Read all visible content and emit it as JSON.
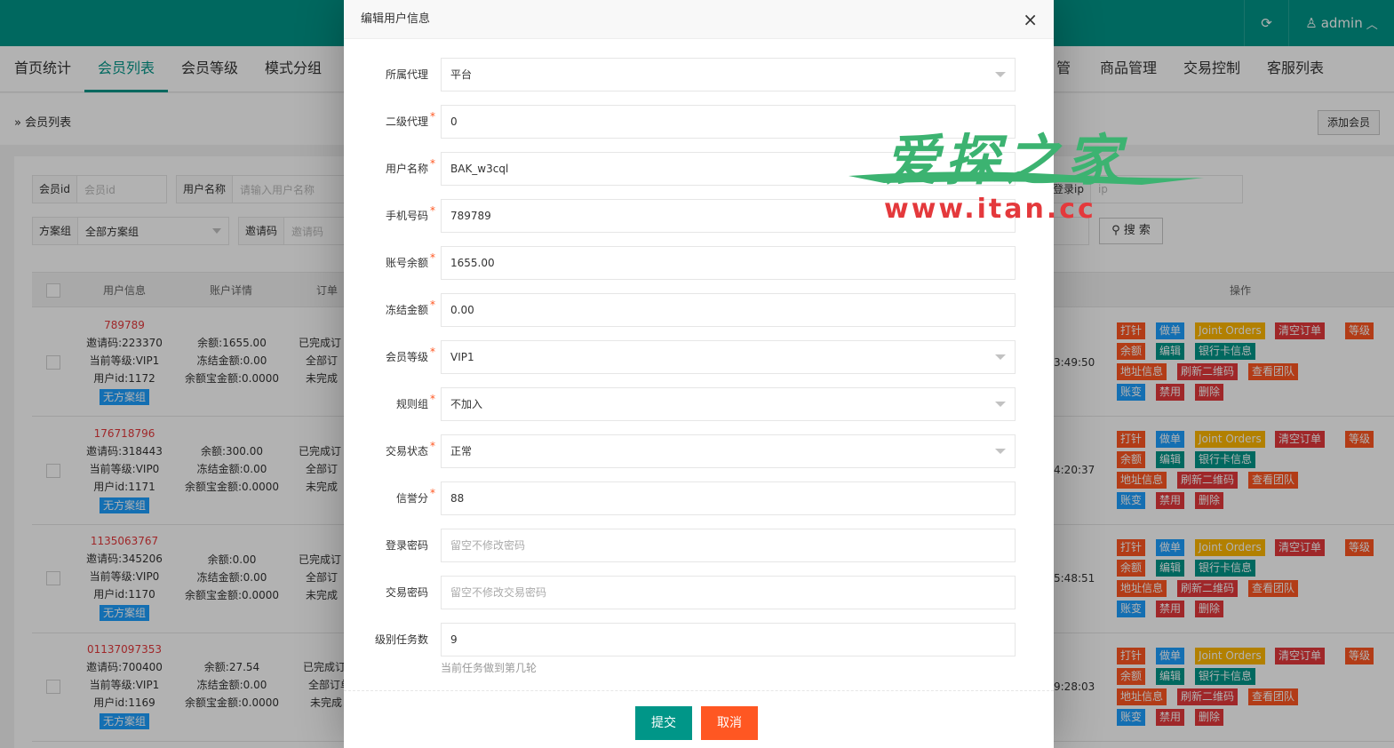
{
  "topbar": {
    "refresh_icon": "⟳",
    "user_icon": "♙",
    "username": "admin",
    "chevron": "︿"
  },
  "nav": {
    "left": [
      "首页统计",
      "会员列表",
      "会员等级",
      "模式分组"
    ],
    "right": [
      "管理",
      "商品管理",
      "交易控制",
      "客服列表"
    ]
  },
  "breadcrumb": "» 会员列表",
  "add_member": "添加会员",
  "filters": {
    "member_id_label": "会员id",
    "member_id_ph": "会员id",
    "username_label": "用户名称",
    "username_ph": "请输入用户名称",
    "login_ip_label": "登录ip",
    "login_ip_ph": "ip",
    "plan_label": "方案组",
    "plan_value": "全部方案组",
    "invite_label": "邀请码",
    "invite_ph": "邀请码",
    "search": "搜 索"
  },
  "table": {
    "headers": {
      "user": "用户信息",
      "account": "账户详情",
      "orders": "订单",
      "ops": "操作"
    },
    "rows": [
      {
        "phone": "789789",
        "invite": "邀请码:223370",
        "level": "当前等级:VIP1",
        "uid": "用户id:1172",
        "plan": "无方案组",
        "balance": "余额:1655.00",
        "frozen": "冻结金额:0.00",
        "yeb": "余额宝金额:0.0000",
        "o1": "已完成订",
        "o2": "全部订",
        "o3": "未完成",
        "time": "3:49:50"
      },
      {
        "phone": "176718796",
        "invite": "邀请码:318443",
        "level": "当前等级:VIP0",
        "uid": "用户id:1171",
        "plan": "无方案组",
        "balance": "余额:300.00",
        "frozen": "冻结金额:0.00",
        "yeb": "余额宝金额:0.0000",
        "o1": "已完成订",
        "o2": "全部订",
        "o3": "未完成",
        "time": "4:20:37"
      },
      {
        "phone": "1135063767",
        "invite": "邀请码:345206",
        "level": "当前等级:VIP0",
        "uid": "用户id:1170",
        "plan": "无方案组",
        "balance": "余额:0.00",
        "frozen": "冻结金额:0.00",
        "yeb": "余额宝金额:0.0000",
        "o1": "已完成订",
        "o2": "全部订",
        "o3": "未完成",
        "time": "5:48:51"
      },
      {
        "phone": "01137097353",
        "invite": "邀请码:700400",
        "level": "当前等级:VIP1",
        "uid": "用户id:1169",
        "plan": "无方案组",
        "balance": "余额:27.54",
        "frozen": "冻结金额:0.00",
        "yeb": "余额宝金额:0.0000",
        "o1": "已完成订",
        "o2": "全部订单",
        "o3": "未完成",
        "time": "9:28:03"
      }
    ],
    "ops": {
      "hit": "打针",
      "do": "做单",
      "joint": "Joint Orders",
      "clear": "清空订单",
      "grade": "等级",
      "balance": "余额",
      "edit": "编辑",
      "bank": "银行卡信息",
      "address": "地址信息",
      "qr": "刷新二维码",
      "team": "查看团队",
      "change": "账变",
      "ban": "禁用",
      "delete": "删除"
    }
  },
  "modal": {
    "title": "编辑用户信息",
    "close": "×",
    "fields": {
      "agent_label": "所属代理",
      "agent_value": "平台",
      "sub_agent_label": "二级代理",
      "sub_agent_value": "0",
      "username_label": "用户名称",
      "username_value": "BAK_w3cql",
      "phone_label": "手机号码",
      "phone_value": "789789",
      "balance_label": "账号余额",
      "balance_value": "1655.00",
      "frozen_label": "冻结金额",
      "frozen_value": "0.00",
      "level_label": "会员等级",
      "level_value": "VIP1",
      "rule_label": "规则组",
      "rule_value": "不加入",
      "trade_status_label": "交易状态",
      "trade_status_value": "正常",
      "credit_label": "信誉分",
      "credit_value": "88",
      "login_pwd_label": "登录密码",
      "login_pwd_ph": "留空不修改密码",
      "trade_pwd_label": "交易密码",
      "trade_pwd_ph": "留空不修改交易密码",
      "task_label": "级别任务数",
      "task_value": "9",
      "task_help": "当前任务做到第几轮"
    },
    "required_mark": "*",
    "submit": "提交",
    "cancel": "取消"
  },
  "watermark": {
    "top": "爱探之家",
    "bottom": "www.itan.cc"
  },
  "colors": {
    "primary": "#009688",
    "danger": "#ff5722",
    "info": "#1e9fff",
    "warn": "#ffb800",
    "red": "#e4393c"
  }
}
